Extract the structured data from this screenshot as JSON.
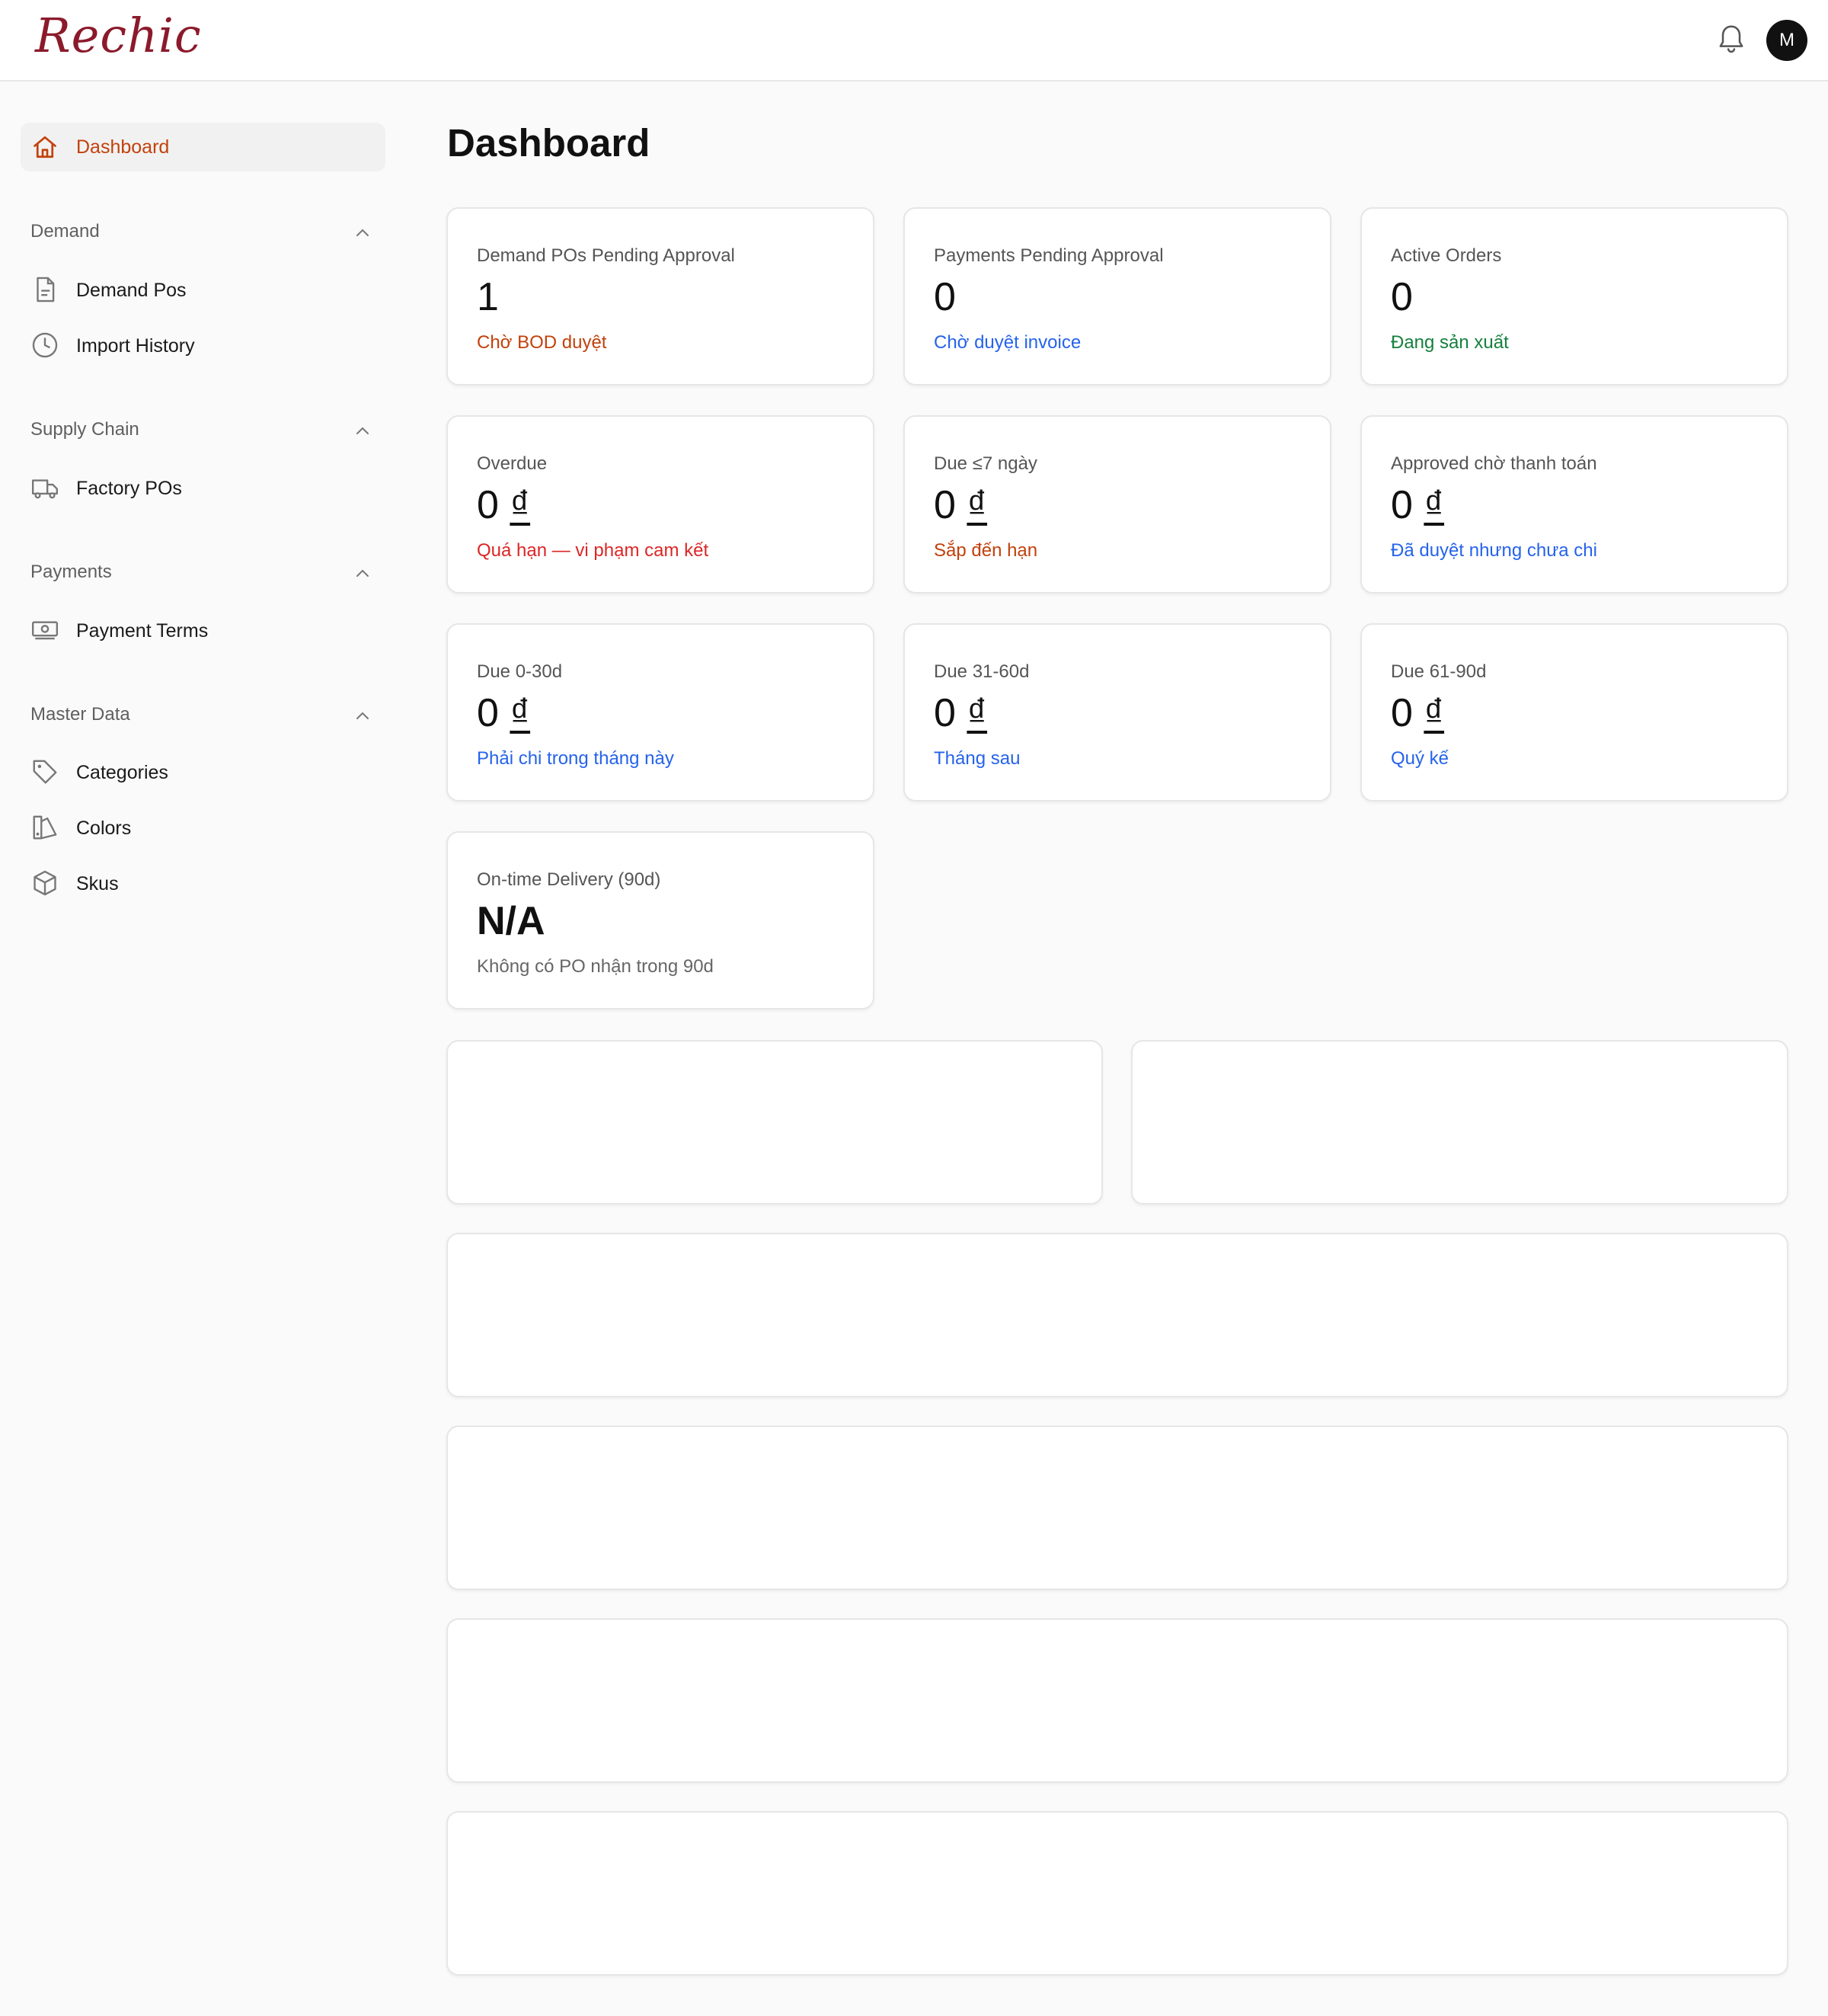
{
  "header": {
    "logo_text": "Rechic",
    "avatar_initial": "M"
  },
  "sidebar": {
    "active_item": {
      "label": "Dashboard",
      "icon": "home-icon"
    },
    "sections": [
      {
        "title": "Demand",
        "items": [
          {
            "label": "Demand Pos",
            "icon": "document-icon"
          },
          {
            "label": "Import History",
            "icon": "clock-icon"
          }
        ]
      },
      {
        "title": "Supply Chain",
        "items": [
          {
            "label": "Factory POs",
            "icon": "truck-icon"
          }
        ]
      },
      {
        "title": "Payments",
        "items": [
          {
            "label": "Payment Terms",
            "icon": "banknote-icon"
          }
        ]
      },
      {
        "title": "Master Data",
        "items": [
          {
            "label": "Categories",
            "icon": "tag-icon"
          },
          {
            "label": "Colors",
            "icon": "palette-icon"
          },
          {
            "label": "Skus",
            "icon": "box-icon"
          }
        ]
      }
    ]
  },
  "main": {
    "title": "Dashboard",
    "stats": [
      {
        "label": "Demand POs Pending Approval",
        "value": "1",
        "sub": "Chờ BOD duyệt",
        "sub_color": "#c2410c"
      },
      {
        "label": "Payments Pending Approval",
        "value": "0",
        "sub": "Chờ duyệt invoice",
        "sub_color": "#2563eb"
      },
      {
        "label": "Active Orders",
        "value": "0",
        "sub": "Đang sản xuất",
        "sub_color": "#15803d"
      },
      {
        "label": "Overdue",
        "value": "0",
        "currency": "₫",
        "sub": "Quá hạn — vi phạm cam kết",
        "sub_color": "#dc2626"
      },
      {
        "label": "Due ≤7 ngày",
        "value": "0",
        "currency": "₫",
        "sub": "Sắp đến hạn",
        "sub_color": "#c2410c"
      },
      {
        "label": "Approved chờ thanh toán",
        "value": "0",
        "currency": "₫",
        "sub": "Đã duyệt nhưng chưa chi",
        "sub_color": "#2563eb"
      },
      {
        "label": "Due 0-30d",
        "value": "0",
        "currency": "₫",
        "sub": "Phải chi trong tháng này",
        "sub_color": "#2563eb"
      },
      {
        "label": "Due 31-60d",
        "value": "0",
        "currency": "₫",
        "sub": "Tháng sau",
        "sub_color": "#2563eb"
      },
      {
        "label": "Due 61-90d",
        "value": "0",
        "currency": "₫",
        "sub": "Quý kế",
        "sub_color": "#2563eb"
      },
      {
        "label": "On-time Delivery (90d)",
        "value": "N/A",
        "sub": "Không có PO nhận trong 90d",
        "sub_color": "#666666"
      }
    ]
  }
}
